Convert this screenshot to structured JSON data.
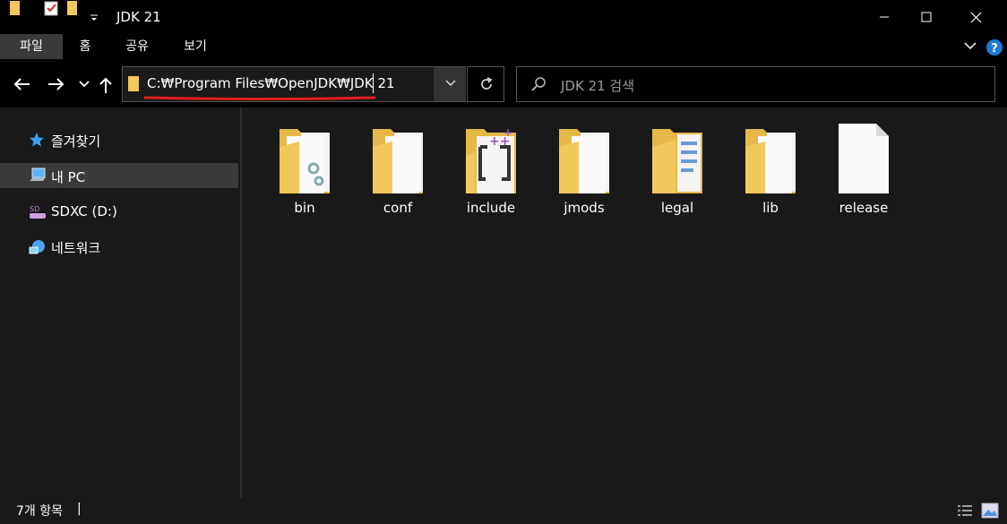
{
  "window": {
    "title": "JDK 21"
  },
  "ribbon": {
    "tabs": [
      "파일",
      "홈",
      "공유",
      "보기"
    ]
  },
  "address": {
    "path": "C:₩Program Files₩OpenJDK₩JDK 21"
  },
  "search": {
    "placeholder": "JDK 21 검색"
  },
  "sidebar": {
    "items": [
      {
        "label": "즐겨찾기",
        "icon": "star-icon"
      },
      {
        "label": "내 PC",
        "icon": "pc-icon",
        "selected": true
      },
      {
        "label": "SDXC (D:)",
        "icon": "sd-card-icon"
      },
      {
        "label": "네트워크",
        "icon": "network-icon"
      }
    ]
  },
  "files": [
    {
      "name": "bin",
      "icon": "folder-gear-icon"
    },
    {
      "name": "conf",
      "icon": "folder-icon"
    },
    {
      "name": "include",
      "icon": "folder-cpp-icon"
    },
    {
      "name": "jmods",
      "icon": "folder-icon"
    },
    {
      "name": "legal",
      "icon": "folder-docs-icon"
    },
    {
      "name": "lib",
      "icon": "folder-icon"
    },
    {
      "name": "release",
      "icon": "file-icon"
    }
  ],
  "status": {
    "count": "7개 항목",
    "cursor": "|"
  },
  "colors": {
    "folder": "#f2c75c",
    "accent_underline": "#e01e1e",
    "background": "#191919"
  }
}
